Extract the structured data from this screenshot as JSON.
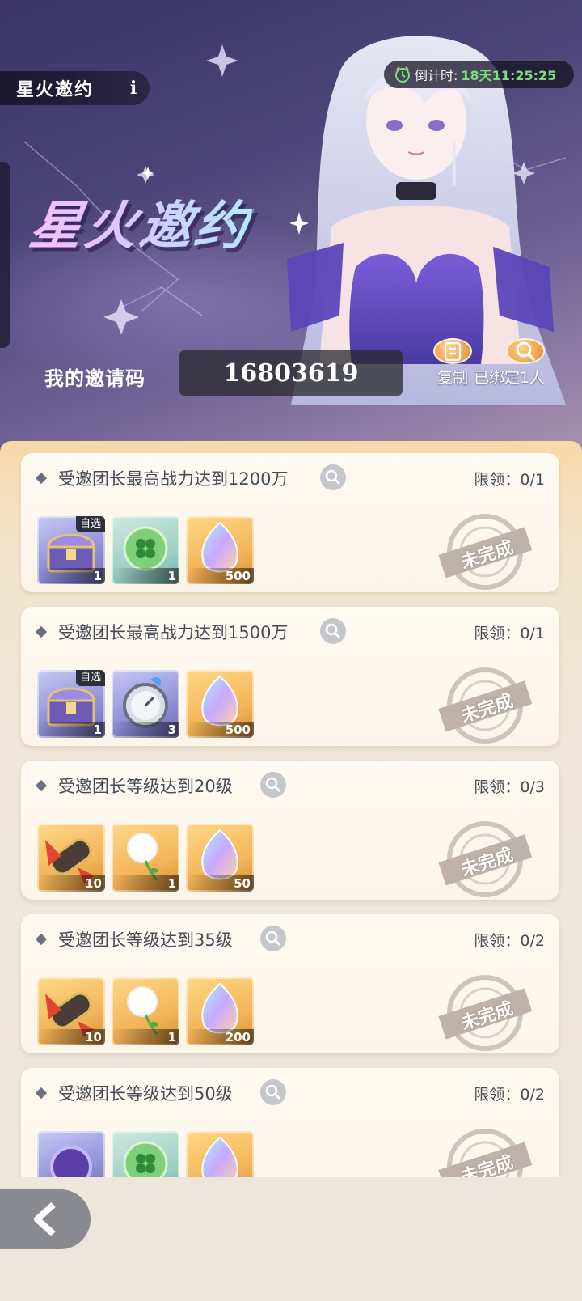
{
  "header": {
    "tab_title": "星火邀约",
    "info_icon": "info-icon",
    "countdown_label": "倒计时:",
    "countdown_value": "18天11:25:25",
    "countdown_icon": "clock-icon",
    "big_title": "星火邀约"
  },
  "invite": {
    "label": "我的邀请码",
    "code": "16803619",
    "copy_label": "复制",
    "copy_icon": "copy-icon",
    "bound_label": "已绑定1人",
    "bound_icon": "search-icon"
  },
  "tasks": [
    {
      "title": "受邀团长最高战力达到1200万",
      "limit": "限领：0/1",
      "status": "未完成",
      "rewards": [
        {
          "icon": "treasure-chest-icon",
          "qty": "1",
          "tag": "自选",
          "bg": "purple"
        },
        {
          "icon": "clover-orb-icon",
          "qty": "1",
          "tag": "",
          "bg": "green"
        },
        {
          "icon": "rainbow-crystal-icon",
          "qty": "500",
          "tag": "",
          "bg": "gold"
        }
      ]
    },
    {
      "title": "受邀团长最高战力达到1500万",
      "limit": "限领：0/1",
      "status": "未完成",
      "rewards": [
        {
          "icon": "treasure-chest-icon",
          "qty": "1",
          "tag": "自选",
          "bg": "purple"
        },
        {
          "icon": "compass-icon",
          "qty": "3",
          "tag": "",
          "bg": "purple"
        },
        {
          "icon": "rainbow-crystal-icon",
          "qty": "500",
          "tag": "",
          "bg": "gold"
        }
      ]
    },
    {
      "title": "受邀团长等级达到20级",
      "limit": "限领：0/3",
      "status": "未完成",
      "rewards": [
        {
          "icon": "scroll-icon",
          "qty": "10",
          "tag": "",
          "bg": "gold"
        },
        {
          "icon": "dandelion-icon",
          "qty": "1",
          "tag": "",
          "bg": "gold"
        },
        {
          "icon": "rainbow-crystal-icon",
          "qty": "50",
          "tag": "",
          "bg": "gold"
        }
      ]
    },
    {
      "title": "受邀团长等级达到35级",
      "limit": "限领：0/2",
      "status": "未完成",
      "rewards": [
        {
          "icon": "scroll-icon",
          "qty": "10",
          "tag": "",
          "bg": "gold"
        },
        {
          "icon": "dandelion-icon",
          "qty": "1",
          "tag": "",
          "bg": "gold"
        },
        {
          "icon": "rainbow-crystal-icon",
          "qty": "200",
          "tag": "",
          "bg": "gold"
        }
      ]
    },
    {
      "title": "受邀团长等级达到50级",
      "limit": "限领：0/2",
      "status": "未完成",
      "rewards": [
        {
          "icon": "purple-orb-icon",
          "qty": "",
          "tag": "",
          "bg": "purple"
        },
        {
          "icon": "clover-orb-icon",
          "qty": "",
          "tag": "",
          "bg": "green"
        },
        {
          "icon": "rainbow-crystal-icon",
          "qty": "",
          "tag": "",
          "bg": "gold"
        }
      ]
    }
  ],
  "nav": {
    "back_icon": "back-arrow-icon"
  },
  "colors": {
    "countdown_value": "#7be07b",
    "accent_orange": "#f0a04e",
    "banner_purple": "#4b4478"
  }
}
